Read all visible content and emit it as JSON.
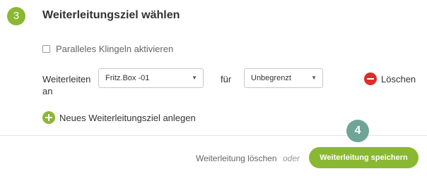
{
  "section": {
    "step_number": "3",
    "title": "Weiterleitungsziel wählen"
  },
  "parallel_ring": {
    "label": "Paralleles Klingeln aktivieren",
    "checked": false
  },
  "forward_row": {
    "label": "Weiterleiten an",
    "device_select": "Fritz.Box -01",
    "for_label": "für",
    "duration_select": "Unbegrenzt",
    "delete_label": "Löschen"
  },
  "add_target": {
    "label": "Neues Weiterleitungsziel anlegen"
  },
  "footer": {
    "step_number": "4",
    "delete_forwarding": "Weiterleitung löschen",
    "or_label": "oder",
    "save_button": "Weiterleitung speichern"
  },
  "colors": {
    "accent_green": "#8ab832",
    "danger_red": "#e12b2b",
    "badge_teal": "#6fa596"
  },
  "icons": {
    "caret": "chevron-down-icon",
    "delete": "minus-circle-icon",
    "add": "plus-circle-icon"
  }
}
